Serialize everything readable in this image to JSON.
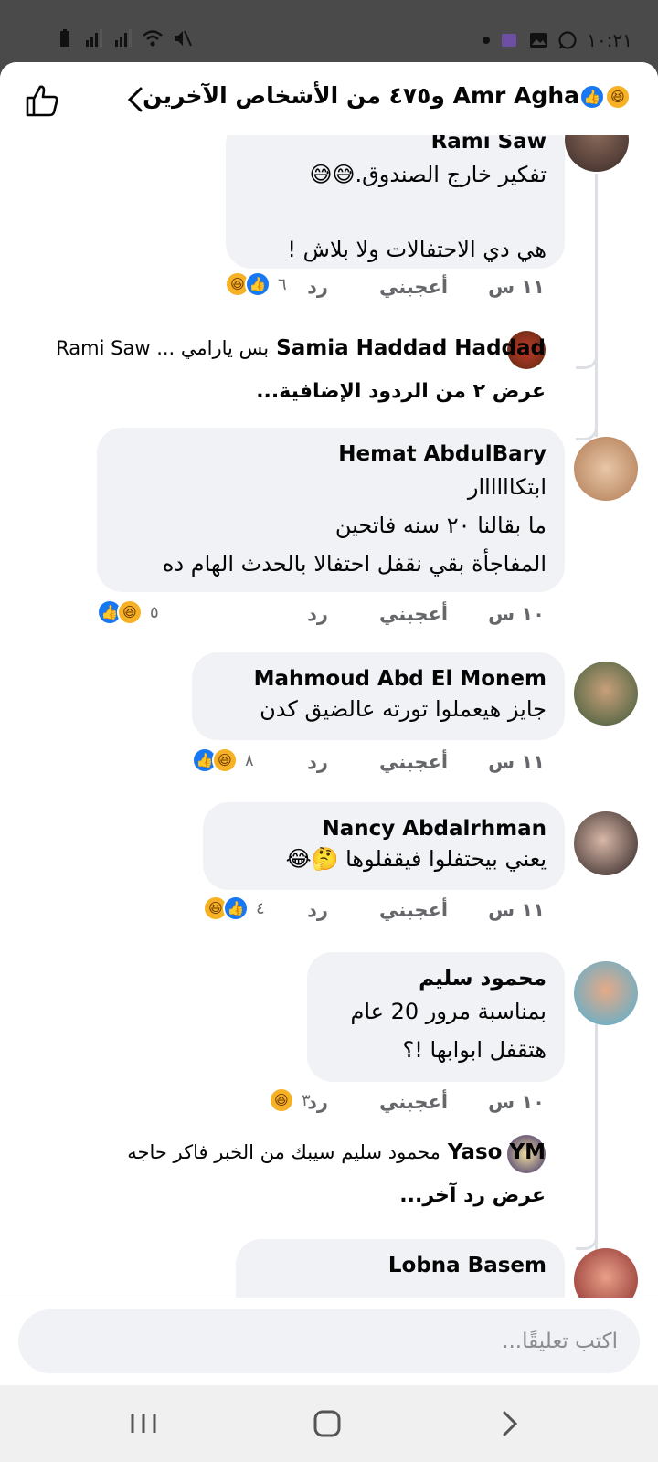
{
  "status_bar": {
    "time": "١٠:٢١"
  },
  "header": {
    "title": "Amr Agha و٤٧٥ من الأشخاص الآخرين",
    "reactions": [
      "haha",
      "like"
    ]
  },
  "comments": [
    {
      "name": "Rami Saw",
      "lines": [
        "تفكير خارج الصندوق.😅😅",
        "",
        "هي دي الاحتفالات ولا بلاش !"
      ],
      "time": "١١ س",
      "like_label": "أعجبني",
      "reply_label": "رد",
      "reaction_count": "٦",
      "reactions": [
        "haha",
        "like"
      ],
      "reply": {
        "name": "Samia Haddad Haddad",
        "text": "بس يارامي ... Rami Saw"
      },
      "more_replies": "عرض ٢ من الردود الإضافية..."
    },
    {
      "name": "Hemat AbdulBary",
      "lines": [
        "ابتكاااااار",
        "ما بقالنا ٢٠ سنه فاتحين",
        "المفاجأة بقي نقفل احتفالا بالحدث الهام ده"
      ],
      "time": "١٠ س",
      "like_label": "أعجبني",
      "reply_label": "رد",
      "reaction_count": "٥",
      "reactions": [
        "like",
        "haha"
      ]
    },
    {
      "name": "Mahmoud Abd El Monem",
      "lines": [
        "جايز هيعملوا تورته عالضيق كدن"
      ],
      "time": "١١ س",
      "like_label": "أعجبني",
      "reply_label": "رد",
      "reaction_count": "٨",
      "reactions": [
        "like",
        "haha"
      ]
    },
    {
      "name": "Nancy Abdalrhman",
      "lines": [
        "يعني بيحتفلوا فيقفلوها 🤔😂"
      ],
      "time": "١١ س",
      "like_label": "أعجبني",
      "reply_label": "رد",
      "reaction_count": "٤",
      "reactions": [
        "haha",
        "like"
      ]
    },
    {
      "name": "محمود سليم",
      "lines": [
        "بمناسبة مرور 20 عام",
        "هتقفل ابوابها !؟"
      ],
      "time": "١٠ س",
      "like_label": "أعجبني",
      "reply_label": "رد",
      "reaction_count": "٣",
      "reactions": [
        "haha"
      ],
      "reply": {
        "name": "Yaso YM",
        "text": "محمود سليم سيبك من الخبر فاكر حاجه"
      },
      "more_replies": "عرض رد آخر..."
    },
    {
      "name": "Lobna Basem",
      "lines": []
    }
  ],
  "composer": {
    "placeholder": "اكتب تعليقًا..."
  },
  "colors": {
    "like_blue": "#1877f2",
    "haha_yellow": "#f7b125",
    "bubble_gray": "#f0f2f5"
  }
}
